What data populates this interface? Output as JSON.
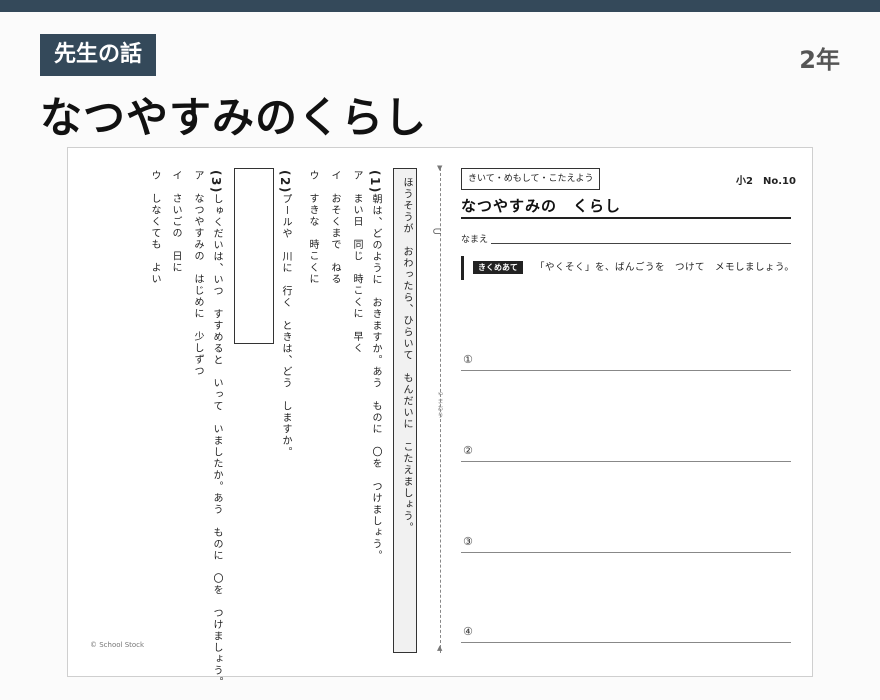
{
  "header": {
    "category": "先生の話",
    "grade": "2年",
    "title": "なつやすみのくらし"
  },
  "worksheet": {
    "instruction": "ほうそうが　おわったら、ひらいて　もんだいに　こたえましょう。",
    "q1": {
      "label": "(1)",
      "question": "朝は、どのように　おきますか。あう　ものに　〇を　つけましょう。",
      "options": [
        "ア　まい日　同じ　時こくに　早く",
        "イ　おそくまで　ねる",
        "ウ　すきな　時こくに"
      ]
    },
    "q2": {
      "label": "(2)",
      "question": "プールや　川に　行く　ときは、どう　しますか。"
    },
    "q3": {
      "label": "(3)",
      "question": "しゅくだいは、いつ　すすめると　いって　いましたか。あう　ものに　〇を　つけましょう。",
      "options": [
        "ア　なつやすみの　はじめに　少しずつ",
        "イ　さいごの　日に",
        "ウ　しなくても　よい"
      ]
    },
    "fold_label": "やまおり",
    "listen_tag": "きいて・めもして・こたえよう",
    "grade_no": "小2　No.10",
    "title": "なつやすみの　くらし",
    "name_label": "なまえ",
    "goal_tag": "きくめあて",
    "goal_text": "「やくそく」を、ばんごうを　つけて　メモしましょう。",
    "memo_numbers": [
      "①",
      "②",
      "③",
      "④"
    ],
    "copyright": "© School Stock"
  }
}
